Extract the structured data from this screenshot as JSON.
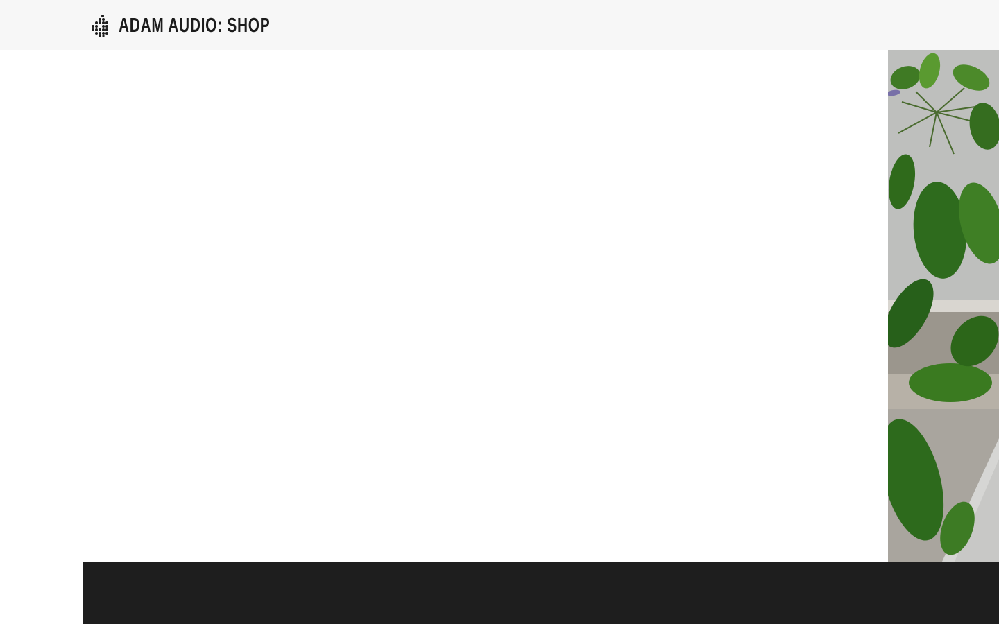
{
  "header": {
    "brand_text": "ADAM AUDIO:  SHOP",
    "logo_icon": "adam-audio-dot-logo-icon",
    "background_color": "#f7f7f7",
    "text_color": "#1c1c1c"
  },
  "hero": {
    "image_subject": "plant-with-green-leaves-icon",
    "background_color": "#ffffff"
  },
  "footer_band": {
    "background_color": "#1e1e1e"
  }
}
